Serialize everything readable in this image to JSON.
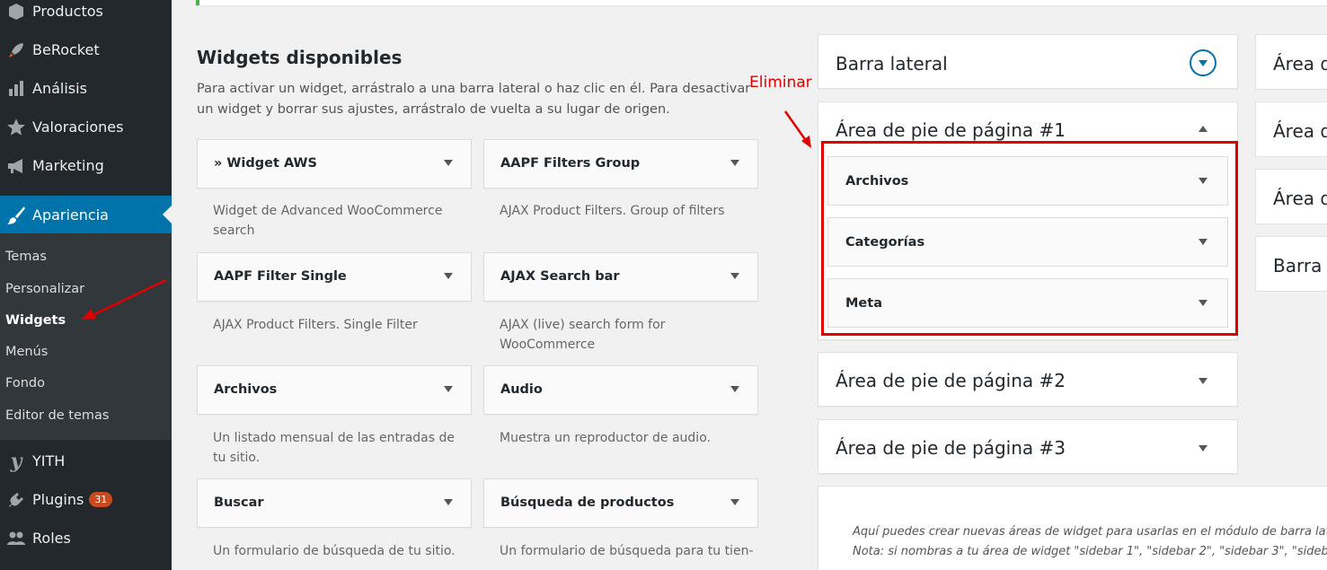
{
  "sidebar": {
    "items": [
      {
        "label": "Productos",
        "icon": "box-icon"
      },
      {
        "label": "BeRocket",
        "icon": "rocket-icon"
      },
      {
        "label": "Análisis",
        "icon": "bar-chart-icon"
      },
      {
        "label": "Valoraciones",
        "icon": "star-icon"
      },
      {
        "label": "Marketing",
        "icon": "megaphone-icon"
      },
      {
        "label": "Apariencia",
        "icon": "paintbrush-icon"
      },
      {
        "label": "YITH",
        "icon": "yith-icon"
      },
      {
        "label": "Plugins",
        "icon": "plug-icon",
        "badge": "31"
      },
      {
        "label": "Roles",
        "icon": "users-icon"
      }
    ],
    "submenu": [
      "Temas",
      "Personalizar",
      "Widgets",
      "Menús",
      "Fondo",
      "Editor de temas"
    ]
  },
  "available": {
    "title": "Widgets disponibles",
    "description": "Para activar un widget, arrástralo a una barra lateral o haz clic en él. Para desactivar un widget y borrar sus ajustes, arrástralo de vuelta a su lugar de origen.",
    "widgets": [
      {
        "title": "» Widget AWS",
        "desc": "Widget de Advanced WooCommerce search"
      },
      {
        "title": "AAPF Filters Group",
        "desc": "AJAX Product Filters. Group of filters"
      },
      {
        "title": "AAPF Filter Single",
        "desc": "AJAX Product Filters. Single Filter"
      },
      {
        "title": "AJAX Search bar",
        "desc": "AJAX (live) search form for WooCommerce"
      },
      {
        "title": "Archivos",
        "desc": "Un listado mensual de las entradas de tu sitio."
      },
      {
        "title": "Audio",
        "desc": "Muestra un reproductor de audio."
      },
      {
        "title": "Buscar",
        "desc": "Un formulario de búsqueda de tu sitio."
      },
      {
        "title": "Búsqueda de productos",
        "desc": "Un formulario de búsqueda para tu tien-"
      }
    ]
  },
  "areas": {
    "barra_lateral": "Barra lateral",
    "footer1": "Área de pie de página #1",
    "footer1_widgets": [
      "Archivos",
      "Categorías",
      "Meta"
    ],
    "footer2": "Área de pie de página #2",
    "footer3": "Área de pie de página #3"
  },
  "right_column": [
    "Área d",
    "Área d",
    "Área d",
    "Barra d"
  ],
  "annotation": {
    "label": "Eliminar",
    "color": "#e00000"
  },
  "help": {
    "line1": "Aquí puedes crear nuevas áreas de widget para usarlas en el módulo de barra late",
    "line2": "Nota: si nombras a tu área de widget \"sidebar 1\", \"sidebar 2\", \"sidebar 3\", \"sidebar"
  },
  "colors": {
    "accent": "#0073aa",
    "sidebar_bg": "#23282d",
    "annotation": "#e00000"
  }
}
